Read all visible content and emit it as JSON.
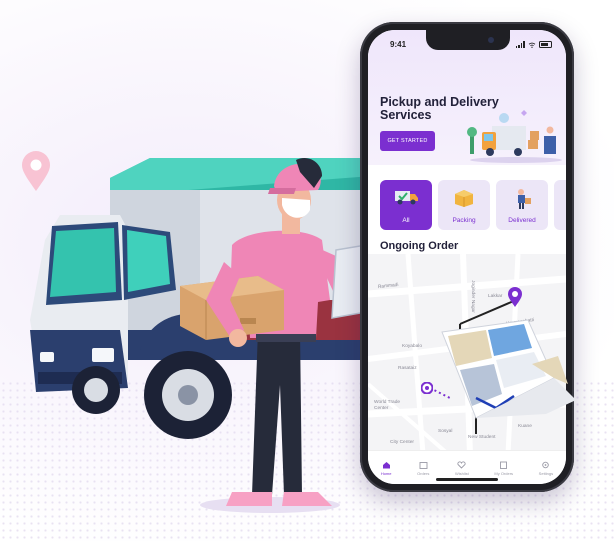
{
  "colors": {
    "accent": "#7b2fd0",
    "hero_bg": "#efe6fb",
    "truck_teal": "#2fb7a5",
    "shirt_pink": "#ef86b6"
  },
  "status_bar": {
    "time": "9:41"
  },
  "hero": {
    "title": "Pickup and Delivery Services",
    "cta_label": "GET STARTED"
  },
  "filters": [
    {
      "label": "All",
      "icon": "truck-icon",
      "active": true
    },
    {
      "label": "Packing",
      "icon": "box-icon",
      "active": false
    },
    {
      "label": "Delivered",
      "icon": "courier-icon",
      "active": false
    }
  ],
  "ongoing": {
    "title": "Ongoing Order"
  },
  "map": {
    "streets": [
      "Joginder Nagar",
      "Rammadi",
      "Lakkar",
      "Ummasabatti",
      "Koyabalo",
      "Rasataiz",
      "World Trade Center",
      "Sosyal",
      "New Student",
      "City Center",
      "Kuane"
    ]
  },
  "tabbar": [
    {
      "label": "Home",
      "icon": "home-icon",
      "active": true
    },
    {
      "label": "Orders",
      "icon": "calendar-icon",
      "active": false
    },
    {
      "label": "Wishlist",
      "icon": "heart-icon",
      "active": false
    },
    {
      "label": "My Orders",
      "icon": "list-icon",
      "active": false
    },
    {
      "label": "Settings",
      "icon": "gear-icon",
      "active": false
    }
  ]
}
